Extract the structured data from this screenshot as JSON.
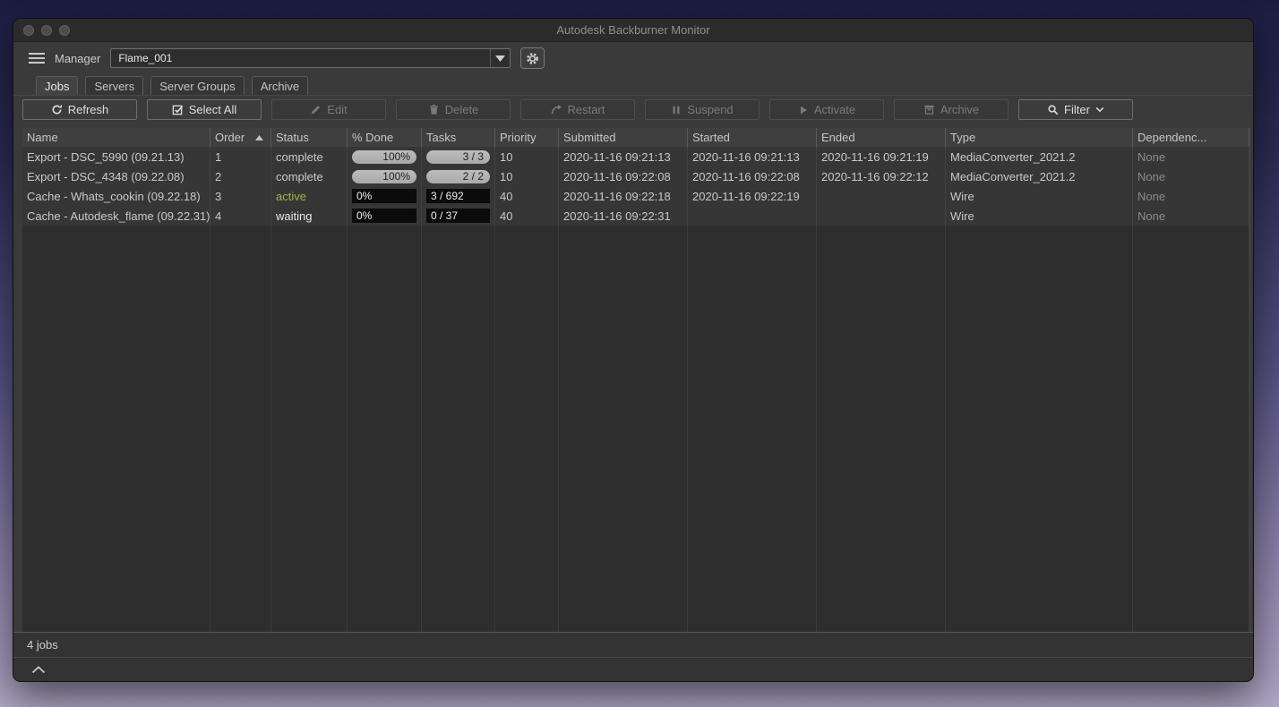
{
  "window": {
    "title": "Autodesk Backburner Monitor"
  },
  "titlebar": {
    "buttons": [
      "close",
      "minimize",
      "zoom"
    ]
  },
  "toolbar": {
    "menu_icon": "hamburger-menu",
    "manager_label": "Manager",
    "manager_value": "Flame_001",
    "dropdown_arrow_icon": "chevron-down",
    "settings_icon": "gear"
  },
  "tabs": [
    {
      "label": "Jobs",
      "active": true
    },
    {
      "label": "Servers",
      "active": false
    },
    {
      "label": "Server Groups",
      "active": false
    },
    {
      "label": "Archive",
      "active": false
    }
  ],
  "actions": [
    {
      "label": "Refresh",
      "icon": "refresh",
      "enabled": true
    },
    {
      "label": "Select All",
      "icon": "select-all",
      "enabled": true
    },
    {
      "label": "Edit",
      "icon": "pencil",
      "enabled": false
    },
    {
      "label": "Delete",
      "icon": "trash",
      "enabled": false
    },
    {
      "label": "Restart",
      "icon": "restart-arrow",
      "enabled": false
    },
    {
      "label": "Suspend",
      "icon": "pause",
      "enabled": false
    },
    {
      "label": "Activate",
      "icon": "play",
      "enabled": false
    },
    {
      "label": "Archive",
      "icon": "archive-box",
      "enabled": false
    },
    {
      "label": "Filter",
      "icon": "search",
      "enabled": true,
      "has_chevron": true
    }
  ],
  "table": {
    "columns": [
      "Name",
      "Order",
      "Status",
      "% Done",
      "Tasks",
      "Priority",
      "Submitted",
      "Started",
      "Ended",
      "Type",
      "Dependenc..."
    ],
    "sort_column_index": 1,
    "sort_direction": "asc",
    "rows": [
      {
        "name": "Export - DSC_5990 (09.21.13)",
        "order": "1",
        "status": "complete",
        "pct_done": "100%",
        "done_display": "pill",
        "tasks": "3 / 3",
        "tasks_display": "pill",
        "priority": "10",
        "submitted": "2020-11-16 09:21:13",
        "started": "2020-11-16 09:21:13",
        "ended": "2020-11-16 09:21:19",
        "type": "MediaConverter_2021.2",
        "dependencies": "None"
      },
      {
        "name": "Export - DSC_4348 (09.22.08)",
        "order": "2",
        "status": "complete",
        "pct_done": "100%",
        "done_display": "pill",
        "tasks": "2 / 2",
        "tasks_display": "pill",
        "priority": "10",
        "submitted": "2020-11-16 09:22:08",
        "started": "2020-11-16 09:22:08",
        "ended": "2020-11-16 09:22:12",
        "type": "MediaConverter_2021.2",
        "dependencies": "None"
      },
      {
        "name": "Cache - Whats_cookin (09.22.18)",
        "order": "3",
        "status": "active",
        "pct_done": "0%",
        "done_display": "bar",
        "tasks": "3 / 692",
        "tasks_display": "bar",
        "priority": "40",
        "submitted": "2020-11-16 09:22:18",
        "started": "2020-11-16 09:22:19",
        "ended": "",
        "type": "Wire",
        "dependencies": "None"
      },
      {
        "name": "Cache - Autodesk_flame (09.22.31)",
        "order": "4",
        "status": "waiting",
        "pct_done": "0%",
        "done_display": "bar",
        "tasks": "0 / 37",
        "tasks_display": "bar",
        "priority": "40",
        "submitted": "2020-11-16 09:22:31",
        "started": "",
        "ended": "",
        "type": "Wire",
        "dependencies": "None"
      }
    ]
  },
  "status_bar": {
    "jobs_count": "4 jobs"
  },
  "colors": {
    "status_active": "#a6b33c",
    "status_waiting": "#e9e9e9",
    "status_complete": "#c9c9c9",
    "pill_bg": "#a9a9a9",
    "bar_bg": "#0b0b0b"
  }
}
